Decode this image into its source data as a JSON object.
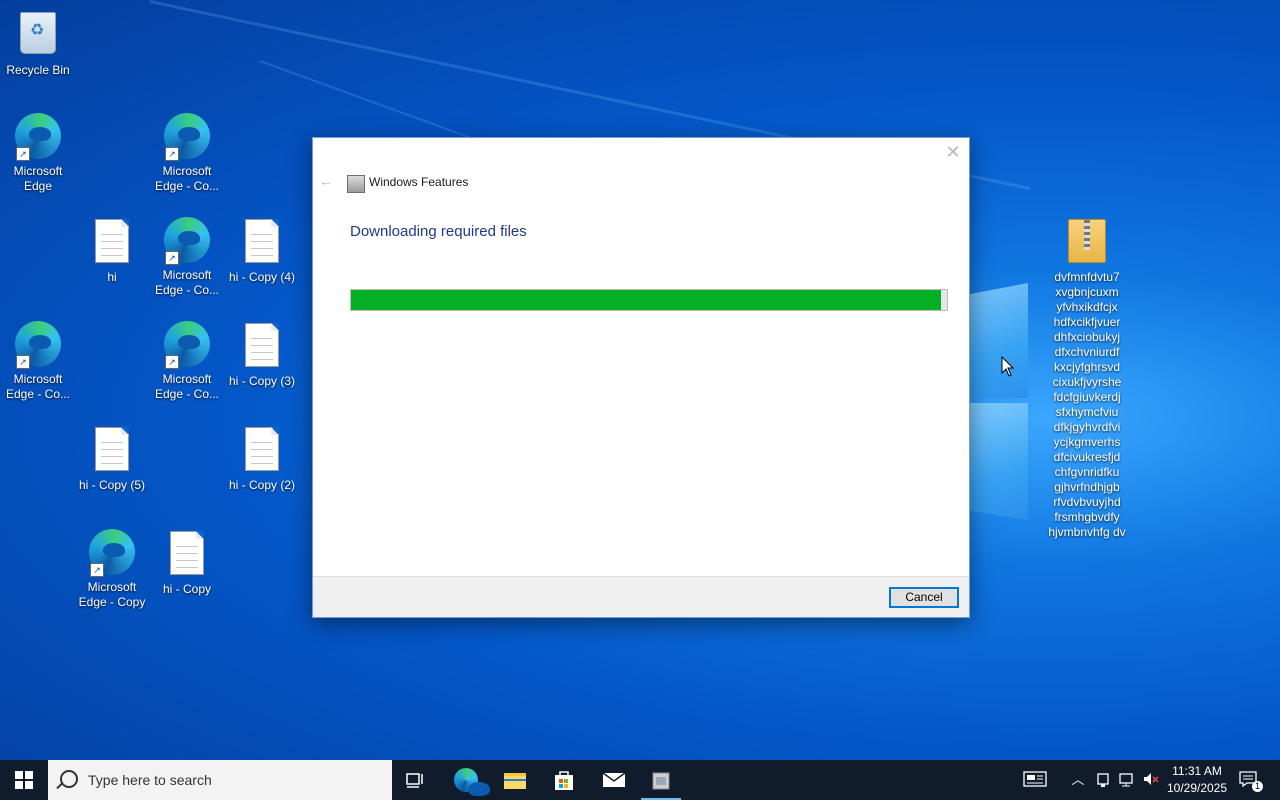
{
  "desktop": {
    "icons": [
      {
        "label": "Recycle Bin",
        "kind": "recycle-bin"
      },
      {
        "label": "Microsoft Edge",
        "kind": "edge"
      },
      {
        "label": "Microsoft Edge - Co...",
        "kind": "edge"
      },
      {
        "label": "hi",
        "kind": "text-file"
      },
      {
        "label": "Microsoft Edge - Co...",
        "kind": "edge"
      },
      {
        "label": "hi - Copy (4)",
        "kind": "text-file"
      },
      {
        "label": "Microsoft Edge - Co...",
        "kind": "edge"
      },
      {
        "label": "Microsoft Edge - Co...",
        "kind": "edge"
      },
      {
        "label": "hi - Copy (3)",
        "kind": "text-file"
      },
      {
        "label": "hi - Copy (5)",
        "kind": "text-file"
      },
      {
        "label": "hi - Copy (2)",
        "kind": "text-file"
      },
      {
        "label": "Microsoft Edge - Copy",
        "kind": "edge"
      },
      {
        "label": "hi - Copy",
        "kind": "text-file"
      },
      {
        "label": "dvfmnfdvtu7 xvgbnjcuxm yfvhxikdfcjx hdfxcikfjvuer dhfxciobukyj dfxchvniurdf kxcjyfghrsvd cixukfjvyrshe fdcfgiuvkerdj sfxhymcfviu dfkjgyhvrdfvi ycjkgmverhs dfcivukresfjd chfgvnridfku gjhvrfndhjgb rfvdvbvuyjhd frsmhgbvdfy hjvmbnvhfg dv",
        "kind": "zip-folder"
      }
    ]
  },
  "dialog": {
    "title": "Windows Features",
    "heading": "Downloading required files",
    "progress": 0.99,
    "cancel_label": "Cancel",
    "back_icon": "back-arrow-icon",
    "close_icon": "close-icon"
  },
  "taskbar": {
    "search_placeholder": "Type here to search",
    "pinned": [
      "task-view-icon",
      "edge-icon",
      "file-explorer-icon",
      "store-icon",
      "mail-icon",
      "windows-features-icon"
    ],
    "clock_time": "11:31 AM",
    "clock_date": "10/29/2025",
    "notification_count": "1"
  },
  "colors": {
    "progress_fill": "#06b025",
    "accent": "#0078d7",
    "taskbar": "#101b2b"
  }
}
